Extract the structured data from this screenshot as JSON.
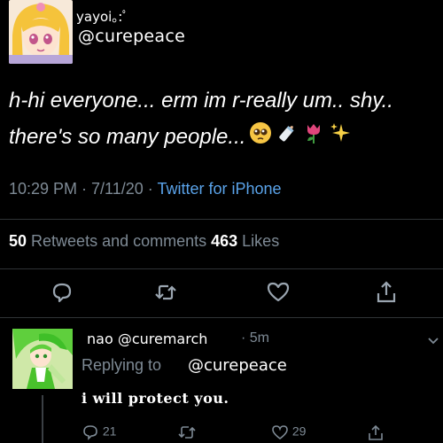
{
  "tweet": {
    "name": "yayoi｡:ﾟ",
    "handle": "@curepeace",
    "text_line1": "h-hi everyone... erm im r-really um.. shy..",
    "text_line2": "there's so many people...",
    "emojis": [
      "pleading-face",
      "baby-bottle",
      "tulip",
      "sparkles"
    ],
    "time": "10:29 PM · 7/11/20 · ",
    "source": "Twitter for iPhone",
    "retweets_count": "50",
    "retweets_label": " Retweets and comments ",
    "likes_count": "463",
    "likes_label": " Likes"
  },
  "reply": {
    "name": "nao @curemarch",
    "time": "· 5m",
    "replying_label": "Replying to",
    "replying_handle": "@curepeace",
    "text": "i will protect you.",
    "reply_count": "21",
    "like_count": "29"
  },
  "colors": {
    "background": "#000000",
    "secondary_text": "#7e8a95",
    "link": "#5aa3ea"
  }
}
